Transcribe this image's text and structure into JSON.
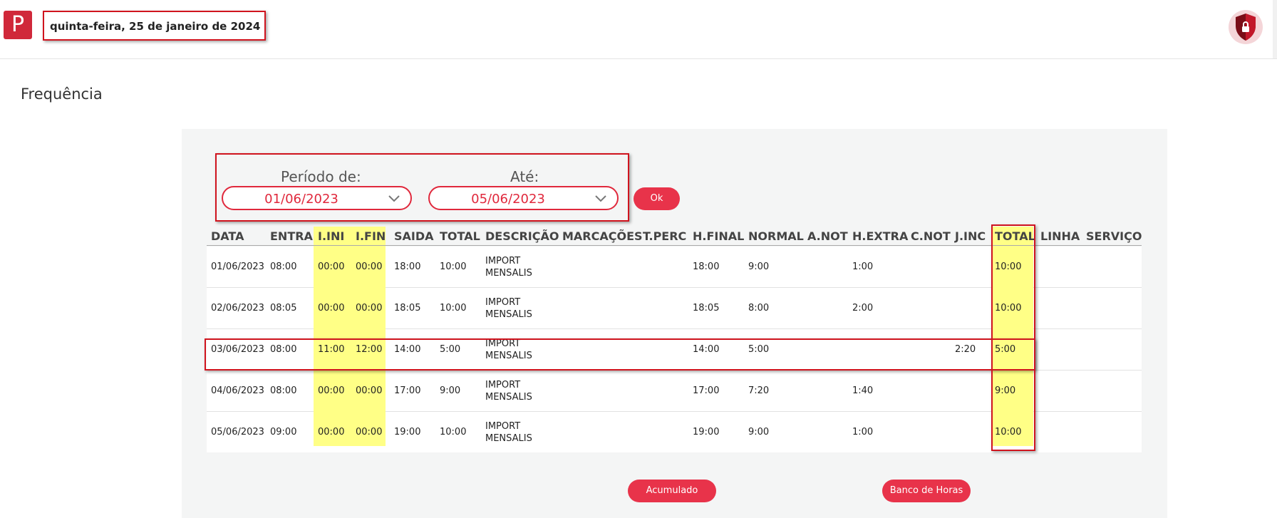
{
  "header": {
    "logo_glyph": "P",
    "date": "quinta-feira, 25 de janeiro de 2024",
    "avatar_icon": "shield-lock-icon"
  },
  "page": {
    "title": "Frequência"
  },
  "filter": {
    "from_label": "Período de:",
    "from_value": "01/06/2023",
    "to_label": "Até:",
    "to_value": "05/06/2023",
    "ok_label": "Ok"
  },
  "table": {
    "headers": [
      "DATA",
      "ENTRA",
      "I.INI",
      "I.FIN",
      "SAIDA",
      "TOTAL",
      "DESCRIÇÃO",
      "MARCAÇÕES",
      "T.PERC",
      "H.FINAL",
      "NORMAL",
      "A.NOT",
      "H.EXTRA",
      "C.NOT",
      "J.INC",
      "TOTAL",
      "LINHA",
      "SERVIÇO"
    ],
    "rows": [
      {
        "data": "01/06/2023",
        "entra": "08:00",
        "iini": "00:00",
        "ifin": "00:00",
        "saida": "18:00",
        "total": "10:00",
        "desc1": "IMPORT",
        "desc2": "MENSALIS",
        "hfinal": "18:00",
        "normal": "9:00",
        "hextra": "1:00",
        "jinc": "",
        "total2": "10:00"
      },
      {
        "data": "02/06/2023",
        "entra": "08:05",
        "iini": "00:00",
        "ifin": "00:00",
        "saida": "18:05",
        "total": "10:00",
        "desc1": "IMPORT",
        "desc2": "MENSALIS",
        "hfinal": "18:05",
        "normal": "8:00",
        "hextra": "2:00",
        "jinc": "",
        "total2": "10:00"
      },
      {
        "data": "03/06/2023",
        "entra": "08:00",
        "iini": "11:00",
        "ifin": "12:00",
        "saida": "14:00",
        "total": "5:00",
        "desc1": "IMPORT",
        "desc2": "MENSALIS",
        "hfinal": "14:00",
        "normal": "5:00",
        "hextra": "",
        "jinc": "2:20",
        "total2": "5:00"
      },
      {
        "data": "04/06/2023",
        "entra": "08:00",
        "iini": "00:00",
        "ifin": "00:00",
        "saida": "17:00",
        "total": "9:00",
        "desc1": "IMPORT",
        "desc2": "MENSALIS",
        "hfinal": "17:00",
        "normal": "7:20",
        "hextra": "1:40",
        "jinc": "",
        "total2": "9:00"
      },
      {
        "data": "05/06/2023",
        "entra": "09:00",
        "iini": "00:00",
        "ifin": "00:00",
        "saida": "19:00",
        "total": "10:00",
        "desc1": "IMPORT",
        "desc2": "MENSALIS",
        "hfinal": "19:00",
        "normal": "9:00",
        "hextra": "1:00",
        "jinc": "",
        "total2": "10:00"
      }
    ]
  },
  "buttons": {
    "accumulated": "Acumulado",
    "hour_bank": "Banco de Horas"
  },
  "colors": {
    "accent": "#e8334a",
    "highlight": "#ffff86",
    "annotation": "#d0141e"
  }
}
